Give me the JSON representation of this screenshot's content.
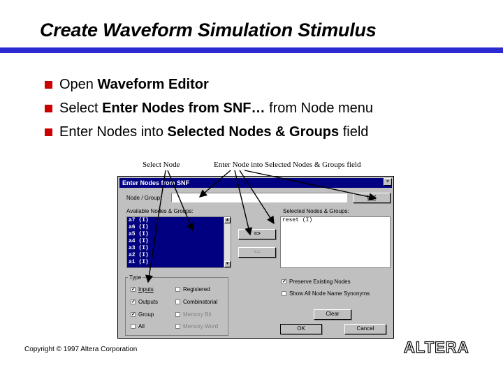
{
  "slide": {
    "title": "Create Waveform Simulation Stimulus",
    "bullets": [
      {
        "pre": "Open ",
        "bold": "Waveform Editor",
        "post": ""
      },
      {
        "pre": "Select ",
        "bold": "Enter Nodes from SNF…",
        "post": " from Node menu"
      },
      {
        "pre": "Enter Nodes into ",
        "bold": "Selected Nodes & Groups",
        "post": " field"
      }
    ],
    "callouts": {
      "select_node": "Select Node",
      "enter_node": "Enter Node into Selected Nodes & Groups field"
    },
    "copyright": "Copyright © 1997 Altera Corporation",
    "logo_text": "ALTERA",
    "accent_rule_color": "#2b2bd1",
    "bullet_color": "#cc0000"
  },
  "dialog": {
    "title": "Enter Nodes from SNF",
    "close_glyph": "×",
    "node_group_label": "Node / Group:",
    "node_group_value": "",
    "list_button": "List",
    "available_label": "Available Nodes & Groups:",
    "available_items": [
      "a7 (I)",
      "a6 (I)",
      "a5 (I)",
      "a4 (I)",
      "a3 (I)",
      "a2 (I)",
      "a1 (I)"
    ],
    "selected_label": "Selected Nodes & Groups:",
    "selected_items": [
      "reset (I)"
    ],
    "add_button": "=>",
    "remove_button": "<=",
    "type_label": "Type",
    "type_options": {
      "inputs": {
        "label": "Inputs",
        "checked": true
      },
      "outputs": {
        "label": "Outputs",
        "checked": true
      },
      "group": {
        "label": "Group",
        "checked": true
      },
      "all": {
        "label": "All",
        "checked": false
      },
      "registered": {
        "label": "Registered",
        "checked": false
      },
      "combinatorial": {
        "label": "Combinatorial",
        "checked": false
      },
      "memory_bit": {
        "label": "Memory Bit",
        "checked": false
      },
      "memory_word": {
        "label": "Memory Word",
        "checked": false
      }
    },
    "preserve_existing": {
      "label": "Preserve Existing Nodes",
      "checked": true
    },
    "show_synonyms": {
      "label": "Show All Node Name Synonyms",
      "checked": false
    },
    "clear_button": "Clear",
    "ok_button": "OK",
    "cancel_button": "Cancel",
    "check_glyph": "✓"
  }
}
